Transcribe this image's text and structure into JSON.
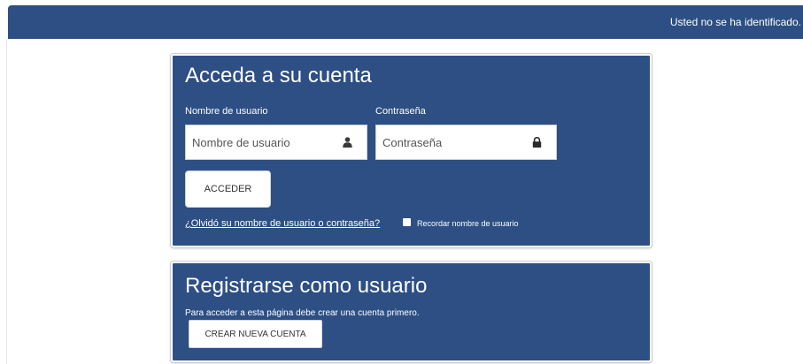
{
  "header": {
    "login_status": "Usted no se ha identificado."
  },
  "login": {
    "title": "Acceda a su cuenta",
    "username_label": "Nombre de usuario",
    "username_placeholder": "Nombre de usuario",
    "username_value": "",
    "username_icon": "user-icon",
    "password_label": "Contraseña",
    "password_placeholder": "Contraseña",
    "password_value": "",
    "password_icon": "lock-icon",
    "submit_label": "ACCEDER",
    "forgot_link": "¿Olvidó su nombre de usuario o contraseña?",
    "remember_label": "Recordar nombre de usuario",
    "remember_checked": false
  },
  "register": {
    "title": "Registrarse como usuario",
    "text": "Para acceder a esta página debe crear una cuenta primero.",
    "button_label": "CREAR NUEVA CUENTA"
  },
  "colors": {
    "primary": "#2d4f84",
    "background": "#ffffff",
    "text_on_primary": "#ffffff"
  }
}
